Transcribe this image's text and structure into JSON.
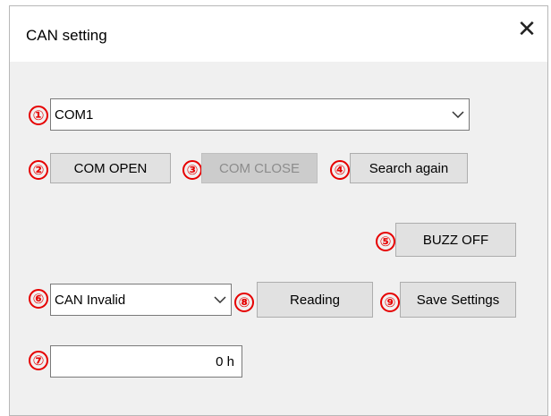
{
  "window": {
    "title": "CAN setting",
    "close_glyph": "✕"
  },
  "port_select": {
    "marker": "①",
    "value": "COM1",
    "icon": "chevron-down-icon"
  },
  "buttons": {
    "com_open": {
      "marker": "②",
      "label": "COM OPEN"
    },
    "com_close": {
      "marker": "③",
      "label": "COM CLOSE",
      "state": "disabled"
    },
    "search_again": {
      "marker": "④",
      "label": "Search again"
    },
    "buzz_off": {
      "marker": "⑤",
      "label": "BUZZ OFF"
    },
    "reading": {
      "marker": "⑧",
      "label": "Reading"
    },
    "save_settings": {
      "marker": "⑨",
      "label": "Save Settings"
    }
  },
  "can_mode_select": {
    "marker": "⑥",
    "value": "CAN Invalid",
    "icon": "chevron-down-icon"
  },
  "hex_field": {
    "marker": "⑦",
    "value": "0 h"
  },
  "colors": {
    "marker": "#e60000",
    "window_bg": "#f0f0f0",
    "button_bg": "#e1e1e1",
    "disabled_bg": "#cccccc"
  }
}
